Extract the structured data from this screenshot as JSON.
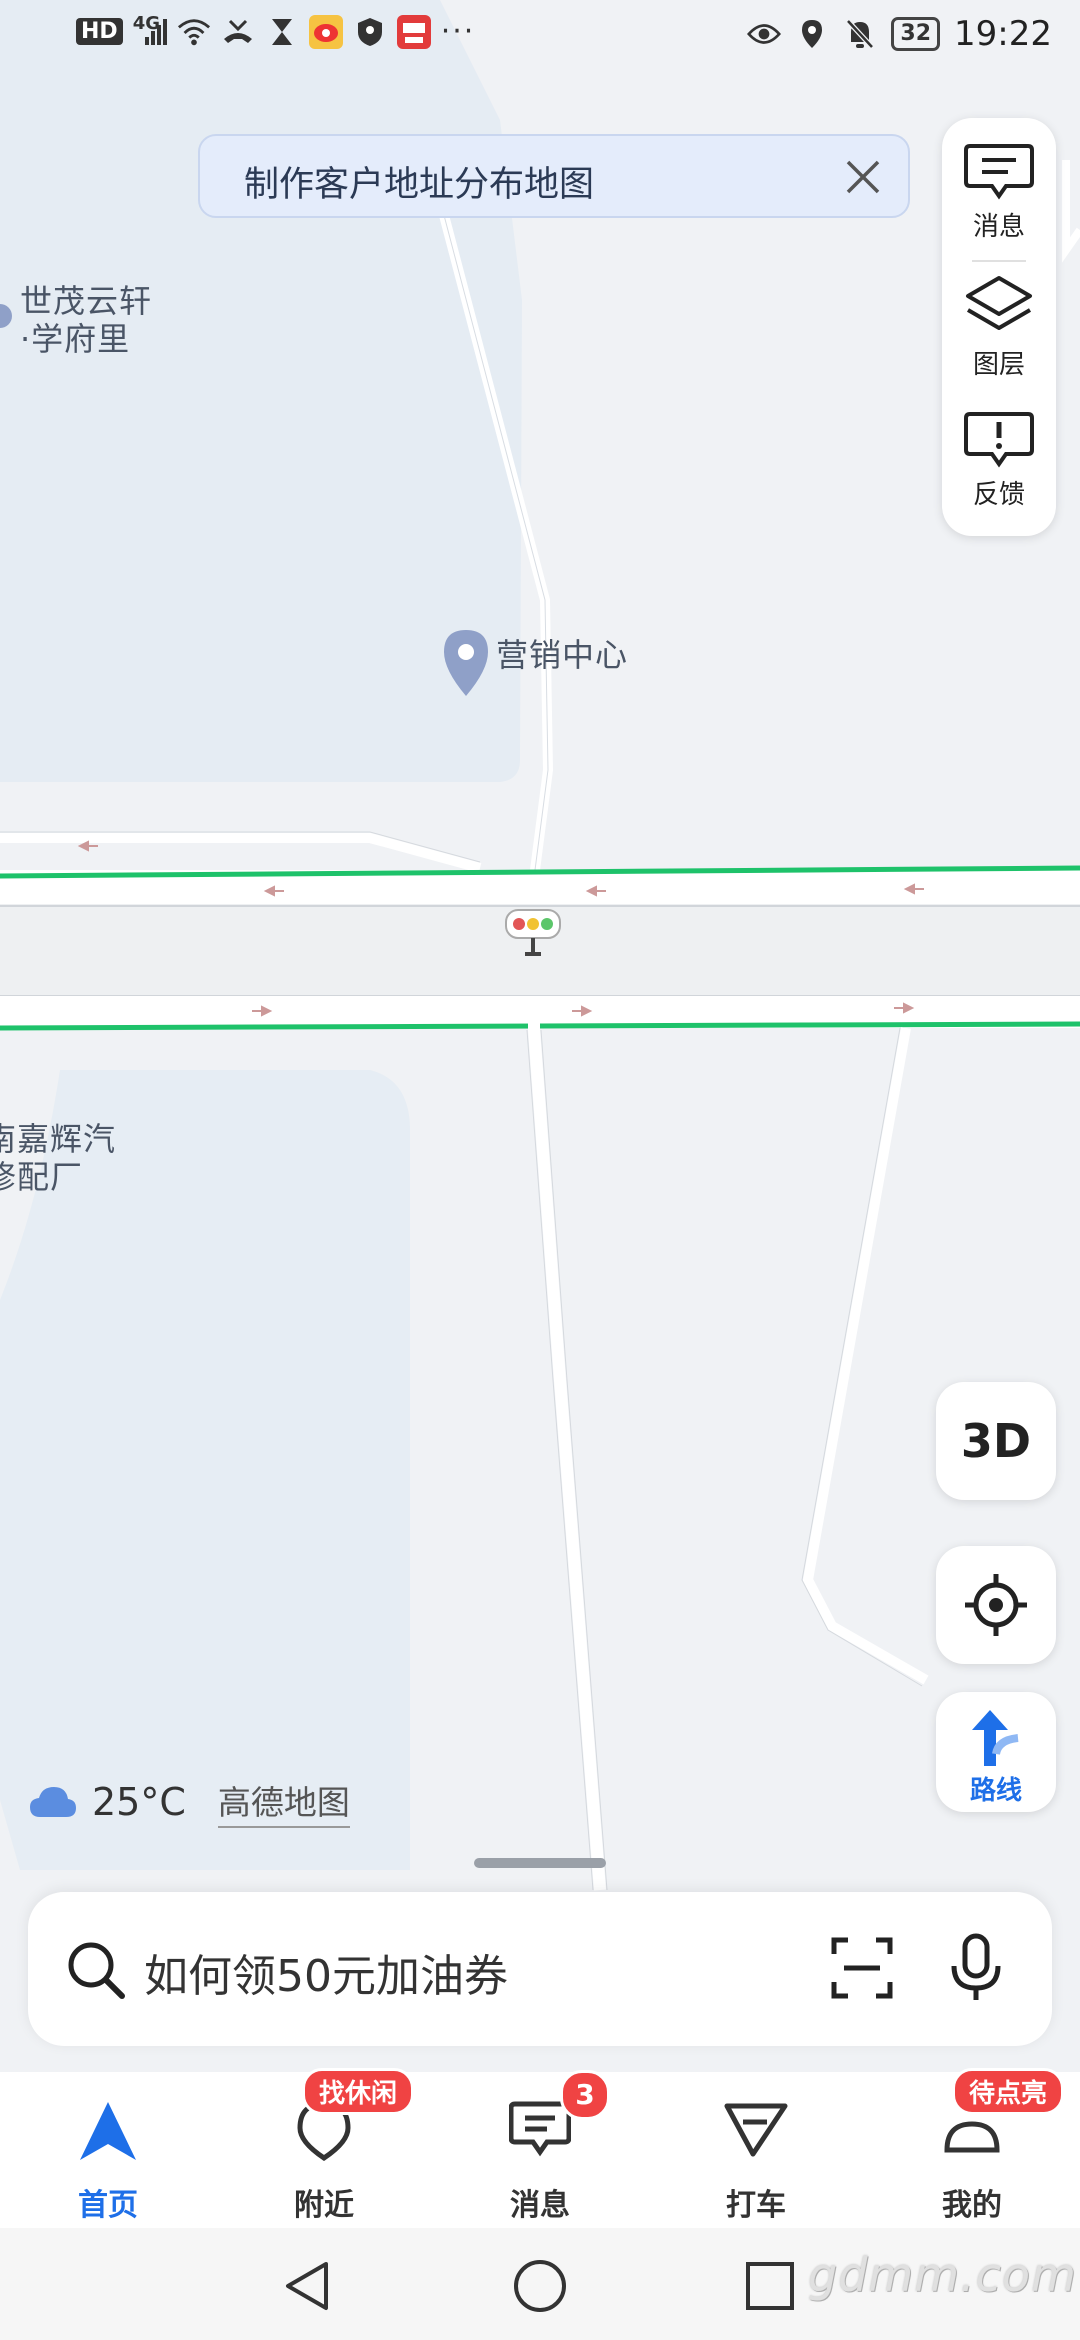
{
  "status_bar": {
    "hd": "HD",
    "network": "4G",
    "dots": "···",
    "battery": "32",
    "time": "19:22"
  },
  "map": {
    "labels": {
      "place1_line1": "世茂云轩",
      "place1_line2": "·学府里",
      "marketing": "营销中心",
      "place3_line1": "南嘉辉汽",
      "place3_line2": "修配厂"
    }
  },
  "banner": {
    "text": "制作客户地址分布地图"
  },
  "side_tools": {
    "messages": "消息",
    "layers": "图层",
    "feedback": "反馈"
  },
  "controls": {
    "three_d": "3D",
    "route": "路线"
  },
  "weather": {
    "temp": "25°C",
    "brand": "高德地图"
  },
  "search": {
    "placeholder": "如何领50元加油券"
  },
  "tabs": [
    {
      "label": "首页",
      "active": true
    },
    {
      "label": "附近",
      "tag": "找休闲"
    },
    {
      "label": "消息",
      "count": "3"
    },
    {
      "label": "打车"
    },
    {
      "label": "我的",
      "tag": "待点亮"
    }
  ],
  "watermark": "gdmm.com",
  "colors": {
    "accent": "#1e6fe8",
    "badge": "#f04343",
    "traffic_green": "#1ec26a"
  }
}
